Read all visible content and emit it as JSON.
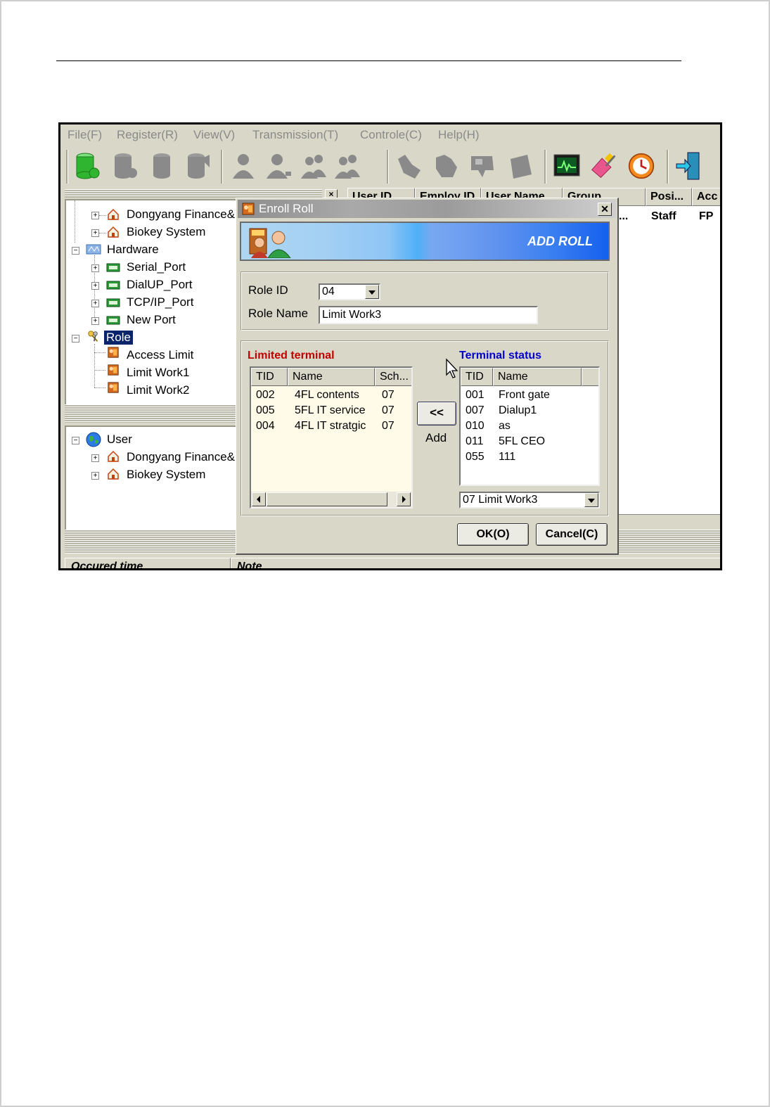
{
  "menu": [
    "File(F)",
    "Register(R)",
    "View(V)",
    "Transmission(T)",
    "Controle(C)",
    "Help(H)"
  ],
  "toolbar_icons": [
    "enroll-db-icon",
    "db-icon-2",
    "db-icon-3",
    "db-icon-4",
    "user-icon",
    "user-edit-icon",
    "users-icon",
    "users-delete-icon",
    "fingerprint-icon",
    "hand-icon",
    "card-icon",
    "device-icon",
    "monitor-icon",
    "eraser-icon",
    "clock-icon",
    "exit-door-icon"
  ],
  "tree_top": {
    "org1": "Dongyang Finance&",
    "org2": "Biokey System",
    "hardware": "Hardware",
    "ports": [
      "Serial_Port",
      "DialUP_Port",
      "TCP/IP_Port",
      "New Port"
    ],
    "role": "Role",
    "roles": [
      "Access Limit",
      "Limit Work1",
      "Limit Work2"
    ]
  },
  "tree_bottom": {
    "user": "User",
    "org1": "Dongyang Finance&",
    "org2": "Biokey System"
  },
  "grid": {
    "headers": [
      "User ID",
      "Employ ID",
      "User Name",
      "Group",
      "Posi...",
      "Acc"
    ],
    "row1": {
      "partial": "...",
      "position": "Staff",
      "access": "FP"
    }
  },
  "log": {
    "headers": [
      "Occured time",
      "Note"
    ]
  },
  "dialog": {
    "title": "Enroll Roll",
    "banner": "ADD ROLL",
    "role_id_label": "Role ID",
    "role_id_value": "04",
    "role_name_label": "Role Name",
    "role_name_value": "Limit Work3",
    "limited_title": "Limited terminal",
    "limited_headers": [
      "TID",
      "Name",
      "Sch..."
    ],
    "limited_rows": [
      [
        "002",
        "4FL contents",
        "07"
      ],
      [
        "005",
        "5FL IT service",
        "07"
      ],
      [
        "004",
        "4FL IT stratgic",
        "07"
      ]
    ],
    "status_title": "Terminal status",
    "status_headers": [
      "TID",
      "Name"
    ],
    "status_rows": [
      [
        "001",
        "Front gate"
      ],
      [
        "007",
        "Dialup1"
      ],
      [
        "010",
        "as"
      ],
      [
        "011",
        "5FL CEO"
      ],
      [
        "055",
        "111"
      ]
    ],
    "add_button": "<<",
    "add_label": "Add",
    "schedule_value": "07 Limit Work3",
    "ok_button": "OK(O)",
    "cancel_button": "Cancel(C)",
    "colors": {
      "limited_title": "#c00000",
      "status_title": "#0000cc",
      "selection": "#0a246a"
    }
  }
}
